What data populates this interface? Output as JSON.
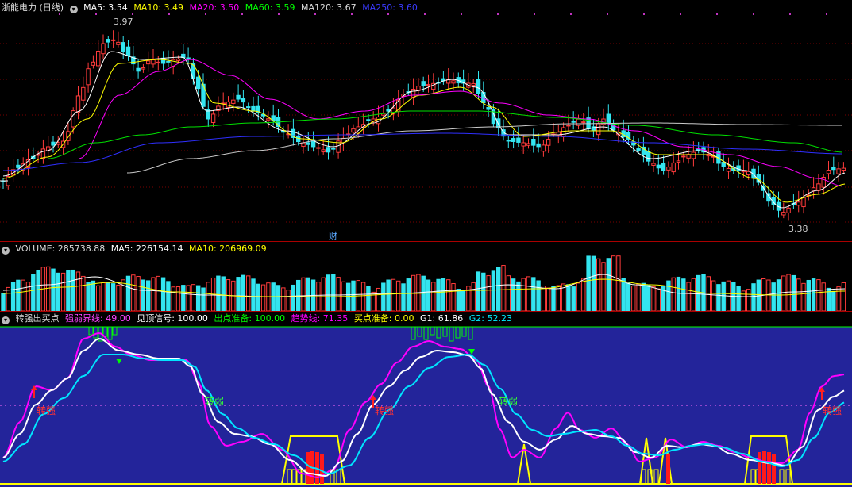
{
  "price": {
    "title": "浙能电力 (日线)",
    "ma": [
      {
        "label": "MA5: 3.54",
        "color": "#ffffff"
      },
      {
        "label": "MA10: 3.49",
        "color": "#ffff00"
      },
      {
        "label": "MA20: 3.50",
        "color": "#ff00ff"
      },
      {
        "label": "MA60: 3.59",
        "color": "#00ff00"
      },
      {
        "label": "MA120: 3.67",
        "color": "#dddddd"
      },
      {
        "label": "MA250: 3.60",
        "color": "#3a3aff"
      }
    ],
    "high_label": "3.97",
    "low_label": "3.38",
    "finance_marker": "财"
  },
  "volume": {
    "label": "VOLUME: 285738.88",
    "ma5": "MA5: 226154.14",
    "ma10": "MA10: 206969.09",
    "colors": {
      "ma5": "#ffffff",
      "ma10": "#ffff00"
    }
  },
  "indicator": {
    "name": "转强出买点",
    "items": [
      {
        "label": "强弱界线: 49.00",
        "color": "#ff44ff"
      },
      {
        "label": "见顶信号: 100.00",
        "color": "#ffffff"
      },
      {
        "label": "出点准备: 100.00",
        "color": "#00ff00"
      },
      {
        "label": "趋势线: 71.35",
        "color": "#ff00ff"
      },
      {
        "label": "买点准备: 0.00",
        "color": "#ffff00"
      },
      {
        "label": "G1: 61.86",
        "color": "#ffffff"
      },
      {
        "label": "G2: 52.23",
        "color": "#00e5ff"
      }
    ],
    "signals": {
      "strong": "转强",
      "weak": "转弱"
    }
  },
  "chart_data": [
    {
      "type": "candlestick",
      "title": "浙能电力 (日线)",
      "annotations": [
        "3.97",
        "3.38",
        "财"
      ],
      "series": [
        {
          "name": "MA5",
          "value": 3.54
        },
        {
          "name": "MA10",
          "value": 3.49
        },
        {
          "name": "MA20",
          "value": 3.5
        },
        {
          "name": "MA60",
          "value": 3.59
        },
        {
          "name": "MA120",
          "value": 3.67
        },
        {
          "name": "MA250",
          "value": 3.6
        }
      ]
    },
    {
      "type": "bar",
      "title": "VOLUME",
      "series": [
        {
          "name": "VOLUME",
          "value": 285738.88
        },
        {
          "name": "MA5",
          "value": 226154.14
        },
        {
          "name": "MA10",
          "value": 206969.09
        }
      ]
    },
    {
      "type": "line",
      "title": "转强出买点",
      "ylim": [
        0,
        100
      ],
      "series": [
        {
          "name": "强弱界线",
          "value": 49.0
        },
        {
          "name": "见顶信号",
          "value": 100.0
        },
        {
          "name": "出点准备",
          "value": 100.0
        },
        {
          "name": "趋势线",
          "value": 71.35
        },
        {
          "name": "买点准备",
          "value": 0.0
        },
        {
          "name": "G1",
          "value": 61.86
        },
        {
          "name": "G2",
          "value": 52.23
        }
      ]
    }
  ]
}
